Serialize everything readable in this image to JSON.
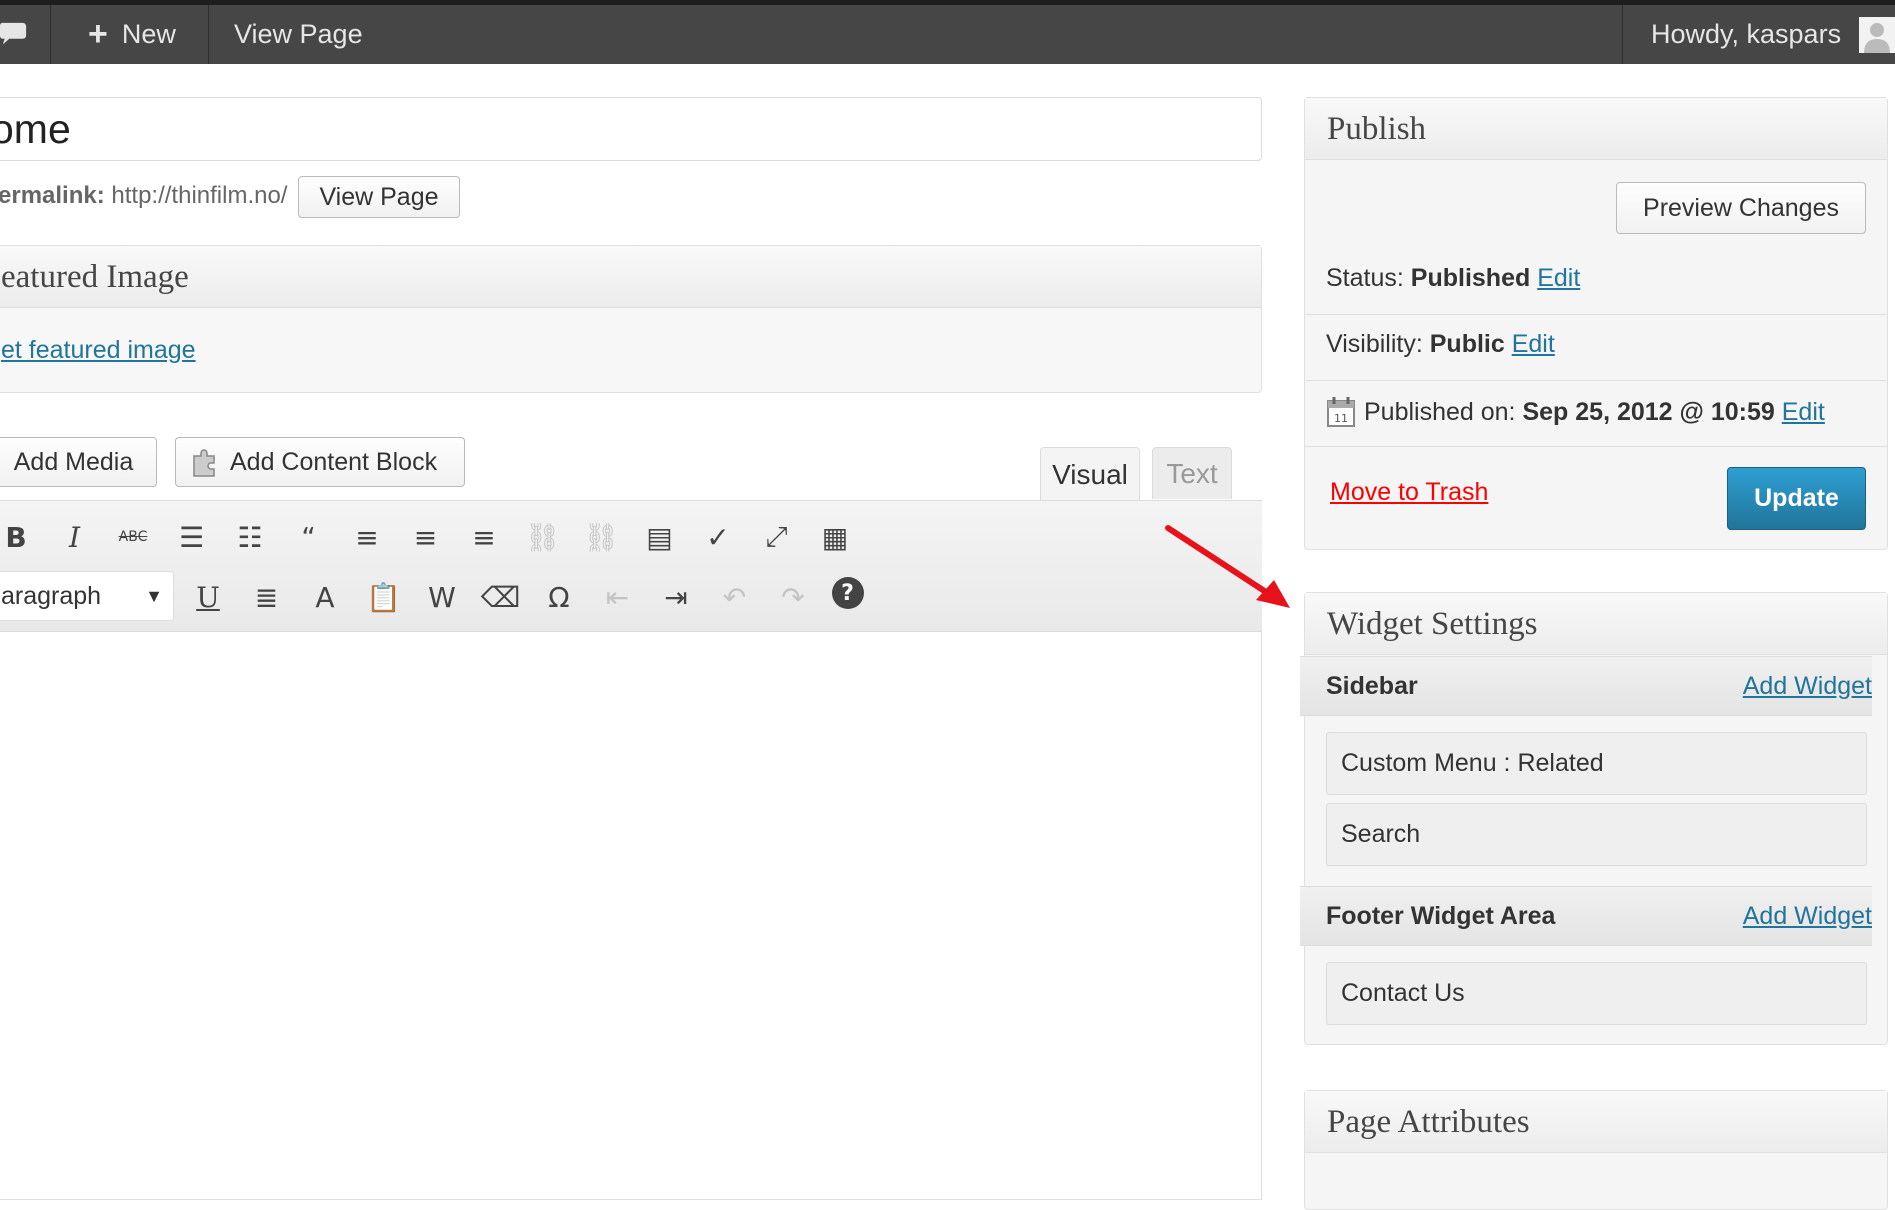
{
  "admin_bar": {
    "new_label": "New",
    "view_page_label": "View Page",
    "howdy_label": "Howdy, kaspars"
  },
  "post": {
    "title": "ome",
    "permalink_label": "ermalink:",
    "permalink_url": "http://thinfilm.no/",
    "view_page_button": "View Page"
  },
  "featured_image": {
    "title": "eatured Image",
    "link": "et featured image"
  },
  "media_buttons": {
    "add_media": "Add Media",
    "add_content_block": "Add Content Block"
  },
  "editor_tabs": {
    "visual": "Visual",
    "text": "Text"
  },
  "format_select": {
    "selected": "aragraph"
  },
  "toolbar_row1": [
    {
      "name": "bold-icon",
      "glyph": "B",
      "dim": false
    },
    {
      "name": "italic-icon",
      "glyph": "I",
      "dim": false
    },
    {
      "name": "strikethrough-icon",
      "glyph": "ABC",
      "dim": false
    },
    {
      "name": "bullet-list-icon",
      "glyph": "☰",
      "dim": false
    },
    {
      "name": "numbered-list-icon",
      "glyph": "☷",
      "dim": false
    },
    {
      "name": "blockquote-icon",
      "glyph": "“",
      "dim": false
    },
    {
      "name": "align-left-icon",
      "glyph": "≡",
      "dim": false
    },
    {
      "name": "align-center-icon",
      "glyph": "≡",
      "dim": false
    },
    {
      "name": "align-right-icon",
      "glyph": "≡",
      "dim": false
    },
    {
      "name": "insert-link-icon",
      "glyph": "⛓",
      "dim": true
    },
    {
      "name": "unlink-icon",
      "glyph": "⛓",
      "dim": true
    },
    {
      "name": "more-tag-icon",
      "glyph": "▤",
      "dim": false
    },
    {
      "name": "spellcheck-icon",
      "glyph": "✓",
      "dim": false
    },
    {
      "name": "fullscreen-icon",
      "glyph": "⤢",
      "dim": false
    },
    {
      "name": "kitchen-sink-icon",
      "glyph": "▦",
      "dim": false
    }
  ],
  "toolbar_row2": [
    {
      "name": "underline-icon",
      "glyph": "U",
      "dim": false
    },
    {
      "name": "justify-icon",
      "glyph": "≣",
      "dim": false
    },
    {
      "name": "text-color-icon",
      "glyph": "A",
      "dim": false
    },
    {
      "name": "paste-text-icon",
      "glyph": "📋",
      "dim": false
    },
    {
      "name": "paste-word-icon",
      "glyph": "W",
      "dim": false
    },
    {
      "name": "clear-formatting-icon",
      "glyph": "⌫",
      "dim": false
    },
    {
      "name": "special-character-icon",
      "glyph": "Ω",
      "dim": false
    },
    {
      "name": "outdent-icon",
      "glyph": "⇤",
      "dim": true
    },
    {
      "name": "indent-icon",
      "glyph": "⇥",
      "dim": false
    },
    {
      "name": "undo-icon",
      "glyph": "↶",
      "dim": true
    },
    {
      "name": "redo-icon",
      "glyph": "↷",
      "dim": true
    },
    {
      "name": "help-icon",
      "glyph": "?",
      "dim": false
    }
  ],
  "publish": {
    "title": "Publish",
    "preview_button": "Preview Changes",
    "status_label": "Status:",
    "status_value": "Published",
    "visibility_label": "Visibility:",
    "visibility_value": "Public",
    "published_label": "Published on:",
    "published_value": "Sep 25, 2012 @ 10:59",
    "edit_label": "Edit",
    "trash_label": "Move to Trash",
    "update_button": "Update"
  },
  "widget_settings": {
    "title": "Widget Settings",
    "add_widget_label": "Add Widget",
    "areas": [
      {
        "name": "Sidebar",
        "widgets": [
          "Custom Menu : Related",
          "Search"
        ]
      },
      {
        "name": "Footer Widget Area",
        "widgets": [
          "Contact Us"
        ]
      }
    ]
  },
  "page_attributes": {
    "title": "Page Attributes"
  },
  "colors": {
    "admin_bar": "#464646",
    "link": "#21759b",
    "trash": "#ff0000",
    "update_button": "#2a8bbb",
    "arrow": "#e8121a"
  }
}
